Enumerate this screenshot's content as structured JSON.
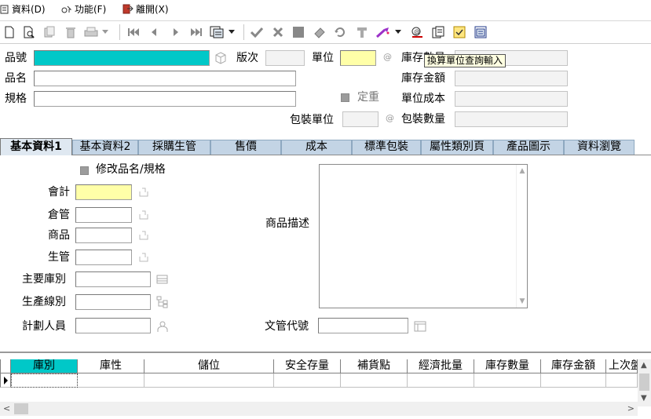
{
  "menu": [
    {
      "label": "資料(D)",
      "icon": "data-icon"
    },
    {
      "label": "功能(F)",
      "icon": "function-icon"
    },
    {
      "label": "離開(X)",
      "icon": "exit-icon"
    }
  ],
  "toolbar": {
    "icons": [
      "new-document-icon",
      "preview-icon",
      "copy-record-icon",
      "delete-icon",
      "print-icon",
      "print-dropdown-icon",
      "first-record-icon",
      "prev-record-icon",
      "next-record-icon",
      "last-record-icon",
      "view-icon",
      "view-dropdown-icon",
      "confirm-icon",
      "cancel-icon",
      "stop-icon",
      "eraser-icon",
      "refresh-icon",
      "tools-icon",
      "wizard-icon",
      "wizard-dropdown-icon",
      "lookup-icon",
      "report-icon",
      "notes-icon",
      "info-icon"
    ]
  },
  "header": {
    "item_no_label": "品號",
    "item_no_value": "",
    "version_label": "版次",
    "version_value": "",
    "unit_label": "單位",
    "unit_value": "",
    "at_symbol": "@",
    "stock_qty_label": "庫存數量",
    "stock_qty_value": "",
    "item_name_label": "品名",
    "item_name_value": "",
    "stock_amount_label": "庫存金額",
    "stock_amount_value": "",
    "spec_label": "規格",
    "spec_value": "",
    "fixed_price_label": "定重",
    "unit_cost_label": "單位成本",
    "unit_cost_value": "",
    "pack_unit_label": "包裝單位",
    "pack_unit_value": "",
    "pack_qty_label": "包裝數量",
    "pack_qty_value": ""
  },
  "tooltip": "換算單位查詢輸入",
  "tabs": [
    {
      "label": "基本資料1",
      "active": true
    },
    {
      "label": "基本資料2",
      "active": false
    },
    {
      "label": "採購生管",
      "active": false
    },
    {
      "label": "售價",
      "active": false
    },
    {
      "label": "成本",
      "active": false
    },
    {
      "label": "標準包裝",
      "active": false
    },
    {
      "label": "屬性類別頁",
      "active": false
    },
    {
      "label": "產品圖示",
      "active": false
    },
    {
      "label": "資料瀏覽",
      "active": false
    }
  ],
  "basic1": {
    "modify_name_label": "修改品名/規格",
    "accounting_label": "會計",
    "warehouse_label": "倉管",
    "product_label": "商品",
    "production_label": "生管",
    "main_warehouse_label": "主要庫別",
    "production_line_label": "生產線別",
    "planner_label": "計劃人員",
    "description_label": "商品描述",
    "doc_code_label": "文管代號"
  },
  "grid": {
    "columns": [
      "庫別",
      "庫性",
      "儲位",
      "安全存量",
      "補貨點",
      "經濟批量",
      "庫存數量",
      "庫存金額",
      "上次盤"
    ],
    "rows": [
      [
        "",
        "",
        "",
        "",
        "",
        "",
        "",
        "",
        ""
      ]
    ]
  }
}
